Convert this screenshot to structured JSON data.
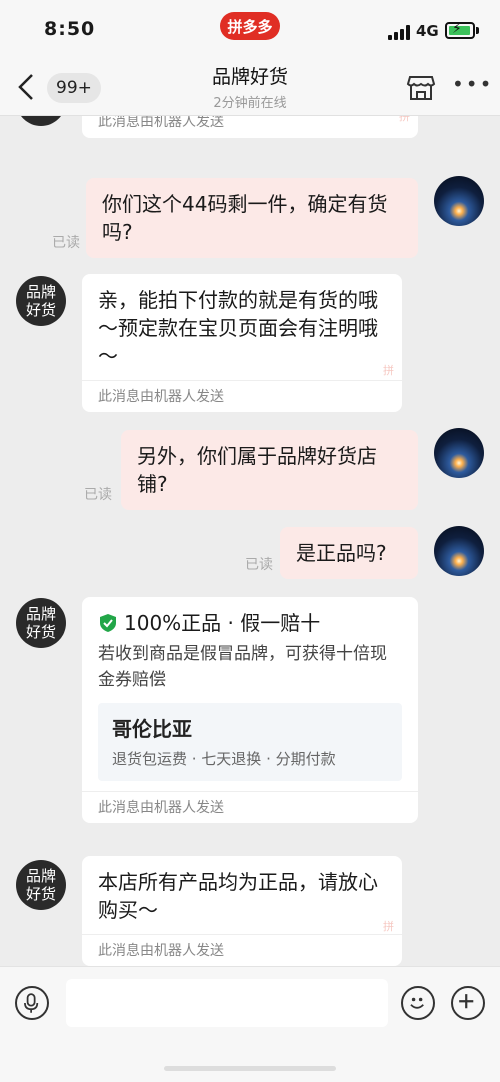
{
  "status_bar": {
    "time": "8:50",
    "network": "4G",
    "app_badge": "拼多多"
  },
  "nav": {
    "unread": "99+",
    "title": "品牌好货",
    "subtitle": "2分钟前在线"
  },
  "shop_avatar_text": "品牌好货",
  "robot_note": "此消息由机器人发送",
  "read_label": "已读",
  "messages": [
    {
      "from": "user",
      "text": "你们这个44码剩一件，确定有货吗?"
    },
    {
      "from": "shop",
      "text": "亲，能拍下付款的就是有货的哦～预定款在宝贝页面会有注明哦～"
    },
    {
      "from": "user",
      "text": "另外，你们属于品牌好货店铺?"
    },
    {
      "from": "user",
      "text": "是正品吗?"
    },
    {
      "from": "shop",
      "card": {
        "title": "100%正品 · 假一赔十",
        "desc": "若收到商品是假冒品牌，可获得十倍现金券赔偿",
        "brand": "哥伦比亚",
        "features": "退货包运费 · 七天退换 · 分期付款"
      }
    },
    {
      "from": "shop",
      "text": "本店所有产品均为正品，请放心购买～"
    }
  ],
  "watermark": "拼",
  "input": {
    "placeholder": ""
  },
  "colors": {
    "brand_red": "#e02e24",
    "outgoing_bubble": "#fce9e7",
    "check_green": "#22a648"
  }
}
